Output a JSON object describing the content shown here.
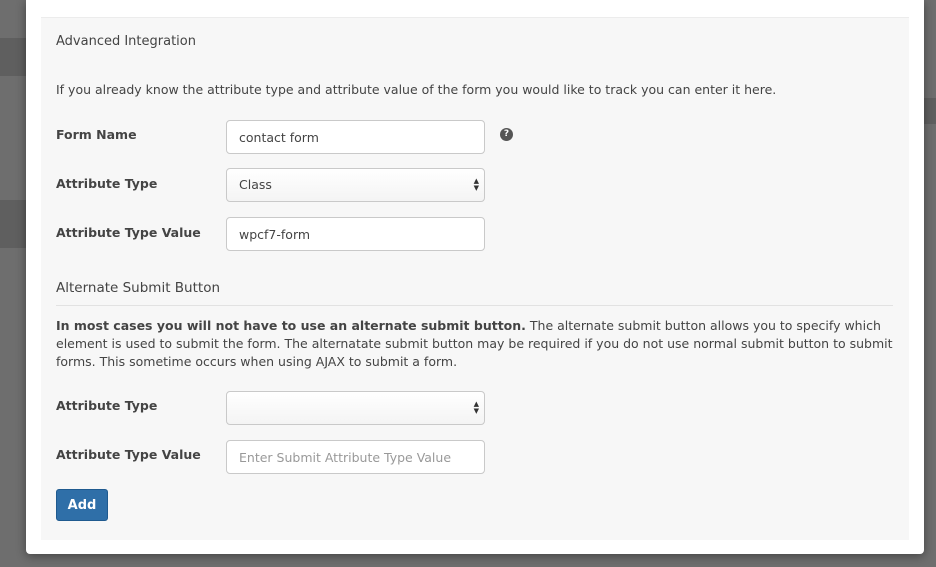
{
  "panel": {
    "title": "Advanced Integration",
    "intro": "If you already know the attribute type and attribute value of the form you would like to track you can enter it here."
  },
  "form": {
    "form_name_label": "Form Name",
    "form_name_value": "contact form",
    "attribute_type_label": "Attribute Type",
    "attribute_type_value": "Class",
    "attribute_type_value_label": "Attribute Type Value",
    "attribute_type_value_value": "wpcf7-form",
    "help_icon": "question-circle-icon"
  },
  "alternate": {
    "title": "Alternate Submit Button",
    "desc_bold": "In most cases you will not have to use an alternate submit button.",
    "desc_rest": " The alternate submit button allows you to specify which element is used to submit the form. The alternatate submit button may be required if you do not use normal submit button to submit forms. This sometime occurs when using AJAX to submit a form.",
    "attribute_type_label": "Attribute Type",
    "attribute_type_value": "",
    "attribute_type_value_label": "Attribute Type Value",
    "attribute_type_value_placeholder": "Enter Submit Attribute Type Value"
  },
  "actions": {
    "add_label": "Add"
  },
  "colors": {
    "primary_button": "#2f6fa8",
    "panel_bg": "#f7f7f7"
  }
}
